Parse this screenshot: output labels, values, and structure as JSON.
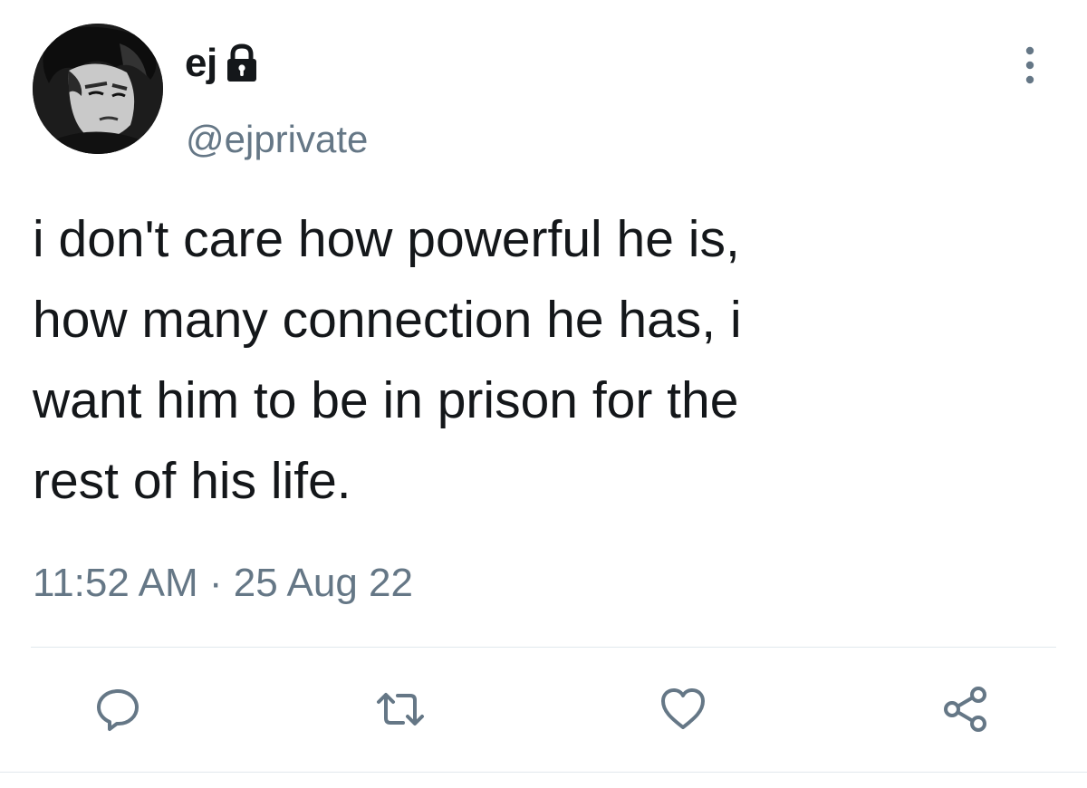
{
  "tweet": {
    "display_name": "ej",
    "handle": "@ejprivate",
    "text_lines": [
      "i don't care how powerful he is,",
      "how many connection he has, i",
      "want him to be in prison for the",
      "rest of his life."
    ],
    "time": "11:52 AM",
    "separator": "·",
    "date": "25 Aug 22"
  },
  "icons": {
    "avatar": "avatar",
    "lock": "lock-icon",
    "more": "more-vertical-icon",
    "reply": "reply-icon",
    "retweet": "retweet-icon",
    "like": "heart-icon",
    "share": "share-icon"
  },
  "colors": {
    "text_primary": "#14171a",
    "text_secondary": "#657786",
    "icon": "#657786",
    "divider": "#e1e8ed"
  }
}
